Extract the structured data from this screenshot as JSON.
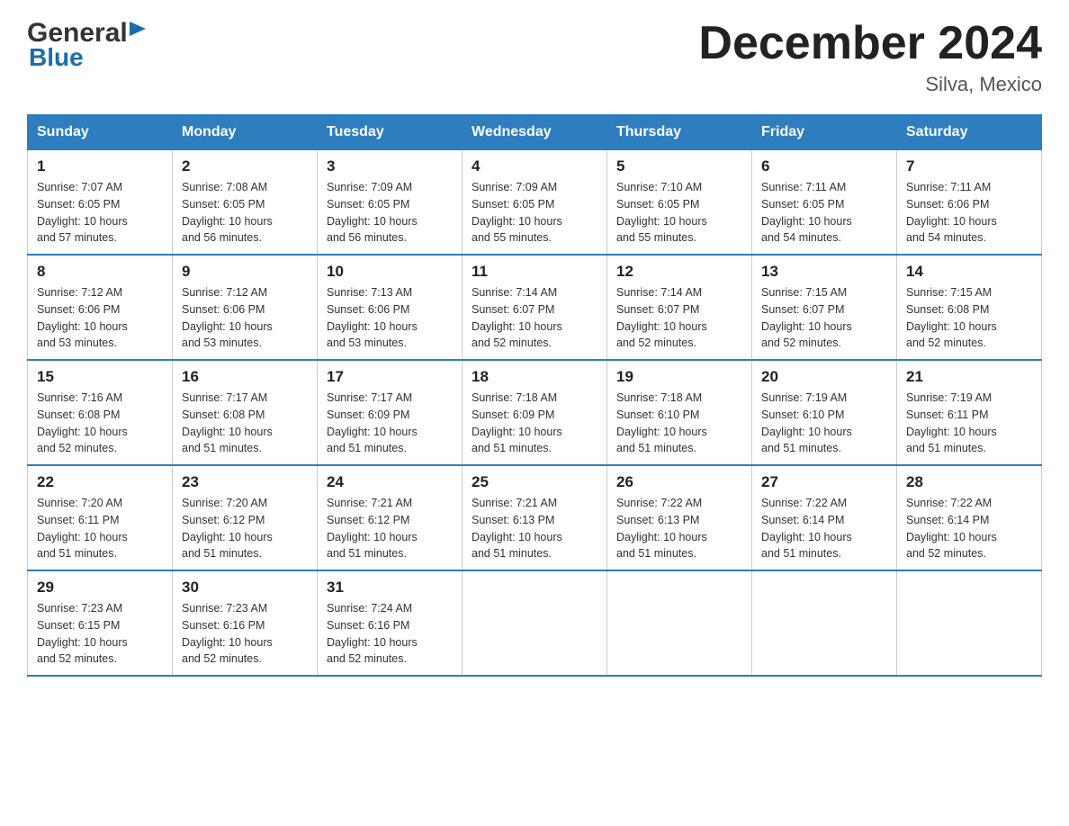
{
  "header": {
    "logo": {
      "line1": "General",
      "line2": "Blue"
    },
    "title": "December 2024",
    "location": "Silva, Mexico"
  },
  "days_of_week": [
    "Sunday",
    "Monday",
    "Tuesday",
    "Wednesday",
    "Thursday",
    "Friday",
    "Saturday"
  ],
  "weeks": [
    [
      {
        "day": "1",
        "sunrise": "7:07 AM",
        "sunset": "6:05 PM",
        "daylight": "10 hours and 57 minutes."
      },
      {
        "day": "2",
        "sunrise": "7:08 AM",
        "sunset": "6:05 PM",
        "daylight": "10 hours and 56 minutes."
      },
      {
        "day": "3",
        "sunrise": "7:09 AM",
        "sunset": "6:05 PM",
        "daylight": "10 hours and 56 minutes."
      },
      {
        "day": "4",
        "sunrise": "7:09 AM",
        "sunset": "6:05 PM",
        "daylight": "10 hours and 55 minutes."
      },
      {
        "day": "5",
        "sunrise": "7:10 AM",
        "sunset": "6:05 PM",
        "daylight": "10 hours and 55 minutes."
      },
      {
        "day": "6",
        "sunrise": "7:11 AM",
        "sunset": "6:05 PM",
        "daylight": "10 hours and 54 minutes."
      },
      {
        "day": "7",
        "sunrise": "7:11 AM",
        "sunset": "6:06 PM",
        "daylight": "10 hours and 54 minutes."
      }
    ],
    [
      {
        "day": "8",
        "sunrise": "7:12 AM",
        "sunset": "6:06 PM",
        "daylight": "10 hours and 53 minutes."
      },
      {
        "day": "9",
        "sunrise": "7:12 AM",
        "sunset": "6:06 PM",
        "daylight": "10 hours and 53 minutes."
      },
      {
        "day": "10",
        "sunrise": "7:13 AM",
        "sunset": "6:06 PM",
        "daylight": "10 hours and 53 minutes."
      },
      {
        "day": "11",
        "sunrise": "7:14 AM",
        "sunset": "6:07 PM",
        "daylight": "10 hours and 52 minutes."
      },
      {
        "day": "12",
        "sunrise": "7:14 AM",
        "sunset": "6:07 PM",
        "daylight": "10 hours and 52 minutes."
      },
      {
        "day": "13",
        "sunrise": "7:15 AM",
        "sunset": "6:07 PM",
        "daylight": "10 hours and 52 minutes."
      },
      {
        "day": "14",
        "sunrise": "7:15 AM",
        "sunset": "6:08 PM",
        "daylight": "10 hours and 52 minutes."
      }
    ],
    [
      {
        "day": "15",
        "sunrise": "7:16 AM",
        "sunset": "6:08 PM",
        "daylight": "10 hours and 52 minutes."
      },
      {
        "day": "16",
        "sunrise": "7:17 AM",
        "sunset": "6:08 PM",
        "daylight": "10 hours and 51 minutes."
      },
      {
        "day": "17",
        "sunrise": "7:17 AM",
        "sunset": "6:09 PM",
        "daylight": "10 hours and 51 minutes."
      },
      {
        "day": "18",
        "sunrise": "7:18 AM",
        "sunset": "6:09 PM",
        "daylight": "10 hours and 51 minutes."
      },
      {
        "day": "19",
        "sunrise": "7:18 AM",
        "sunset": "6:10 PM",
        "daylight": "10 hours and 51 minutes."
      },
      {
        "day": "20",
        "sunrise": "7:19 AM",
        "sunset": "6:10 PM",
        "daylight": "10 hours and 51 minutes."
      },
      {
        "day": "21",
        "sunrise": "7:19 AM",
        "sunset": "6:11 PM",
        "daylight": "10 hours and 51 minutes."
      }
    ],
    [
      {
        "day": "22",
        "sunrise": "7:20 AM",
        "sunset": "6:11 PM",
        "daylight": "10 hours and 51 minutes."
      },
      {
        "day": "23",
        "sunrise": "7:20 AM",
        "sunset": "6:12 PM",
        "daylight": "10 hours and 51 minutes."
      },
      {
        "day": "24",
        "sunrise": "7:21 AM",
        "sunset": "6:12 PM",
        "daylight": "10 hours and 51 minutes."
      },
      {
        "day": "25",
        "sunrise": "7:21 AM",
        "sunset": "6:13 PM",
        "daylight": "10 hours and 51 minutes."
      },
      {
        "day": "26",
        "sunrise": "7:22 AM",
        "sunset": "6:13 PM",
        "daylight": "10 hours and 51 minutes."
      },
      {
        "day": "27",
        "sunrise": "7:22 AM",
        "sunset": "6:14 PM",
        "daylight": "10 hours and 51 minutes."
      },
      {
        "day": "28",
        "sunrise": "7:22 AM",
        "sunset": "6:14 PM",
        "daylight": "10 hours and 52 minutes."
      }
    ],
    [
      {
        "day": "29",
        "sunrise": "7:23 AM",
        "sunset": "6:15 PM",
        "daylight": "10 hours and 52 minutes."
      },
      {
        "day": "30",
        "sunrise": "7:23 AM",
        "sunset": "6:16 PM",
        "daylight": "10 hours and 52 minutes."
      },
      {
        "day": "31",
        "sunrise": "7:24 AM",
        "sunset": "6:16 PM",
        "daylight": "10 hours and 52 minutes."
      },
      null,
      null,
      null,
      null
    ]
  ],
  "labels": {
    "sunrise": "Sunrise:",
    "sunset": "Sunset:",
    "daylight": "Daylight:"
  }
}
